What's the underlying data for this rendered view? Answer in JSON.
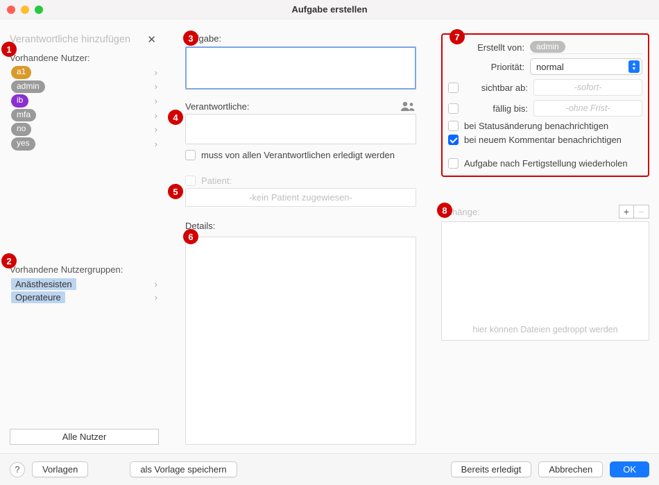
{
  "title": "Aufgabe erstellen",
  "markers": [
    "1",
    "2",
    "3",
    "4",
    "5",
    "6",
    "7",
    "8"
  ],
  "left": {
    "pane_title": "Verantwortliche hinzufügen",
    "users_label": "Vorhandene Nutzer:",
    "users": [
      {
        "name": "a1",
        "color": "#d99a2b"
      },
      {
        "name": "admin",
        "color": "#9a9a9a"
      },
      {
        "name": "ib",
        "color": "#8a2fd0"
      },
      {
        "name": "mfa",
        "color": "#9a9a9a"
      },
      {
        "name": "no",
        "color": "#9a9a9a"
      },
      {
        "name": "yes",
        "color": "#9a9a9a"
      }
    ],
    "groups_label": "Vorhandene Nutzergruppen:",
    "groups": [
      "Anästhesisten",
      "Operateure"
    ],
    "all_users_btn": "Alle Nutzer"
  },
  "center": {
    "task_label": "Aufgabe:",
    "responsible_label": "Verantwortliche:",
    "all_responsible_check": "muss von allen Verantwortlichen erledigt werden",
    "patient_label": "Patient:",
    "patient_placeholder": "-kein Patient zugewiesen-",
    "details_label": "Details:"
  },
  "right": {
    "created_by_label": "Erstellt von:",
    "created_by_value": "admin",
    "priority_label": "Priorität:",
    "priority_value": "normal",
    "visible_from_label": "sichtbar ab:",
    "visible_from_placeholder": "-sofort-",
    "due_label": "fällig bis:",
    "due_placeholder": "-ohne Frist-",
    "notify_status_label": "bei Statusänderung benachrichtigen",
    "notify_comment_label": "bei neuem Kommentar benachrichtigen",
    "repeat_label": "Aufgabe nach Fertigstellung wiederholen",
    "attachments_label": "Anhänge:",
    "drop_hint": "hier können Dateien gedroppt werden"
  },
  "footer": {
    "help": "?",
    "templates": "Vorlagen",
    "save_template": "als Vorlage speichern",
    "done": "Bereits erledigt",
    "cancel": "Abbrechen",
    "ok": "OK"
  }
}
